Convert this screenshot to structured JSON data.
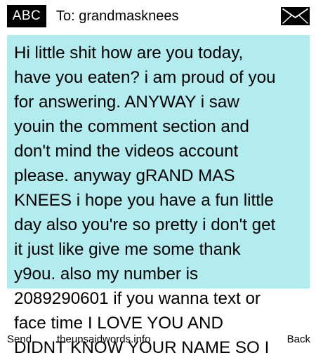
{
  "header": {
    "mode_label": "ABC",
    "to_prefix": "To:",
    "recipient": "grandmasknees",
    "icon": "envelope-icon"
  },
  "message": {
    "body": "Hi little shit how are you today,\nhave you eaten? i am proud of you\nfor answering.  ANYWAY i saw\nyouin the comment section and\ndon't mind the videos account\nplease.  anyway gRAND MAS\nKNEES i hope you have a fun little\nday also you're so pretty i don't get\nit just like give me some thank\ny9ou.  also my number is\n2089290601 if you wanna text or\nface time I LOVE YOU AND\nDIDNT KNOW YOUR NAME SO I"
  },
  "softkeys": {
    "left_label": "Send",
    "center_label": "theunsaidwords.info",
    "right_label": "Back"
  },
  "colors": {
    "message_background": "#b2ecef",
    "header_badge": "#000000"
  }
}
